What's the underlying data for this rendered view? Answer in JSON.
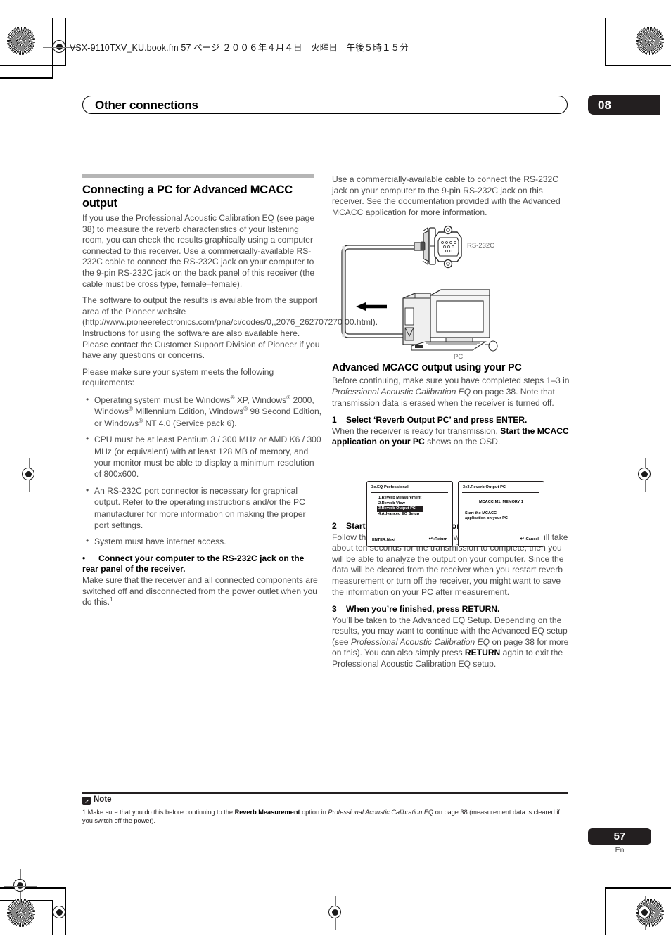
{
  "header": {
    "fm_line": "VSX-9110TXV_KU.book.fm 57 ページ ２００６年４月４日　火曜日　午後５時１５分"
  },
  "chapter": {
    "title": "Other connections",
    "number": "08"
  },
  "left_column": {
    "section_heading": "Connecting a PC for Advanced MCACC output",
    "p1_a": "If you use the Professional Acoustic Calibration EQ (see page 38) to measure the reverb characteristics of your listening room, you can check the results graphically using a computer connected to this receiver. Use a commercially-available RS-232C cable to connect the RS-232C jack on your computer to the 9-pin RS-232C jack on the back panel of this receiver (the cable must be cross type, female–female).",
    "p2": "The software to output the results is available from the support area of the Pioneer website (http://www.pioneerelectronics.com/pna/ci/codes/0,,2076_262707270,00.html). Instructions for using the software are also available here. Please contact the Customer Support Division of Pioneer if you have any questions or concerns.",
    "p3": "Please make sure your system meets the following requirements:",
    "requirements": [
      {
        "parts": [
          {
            "t": "Operating system must be Windows"
          },
          {
            "t": "®",
            "style": "reg"
          },
          {
            "t": " XP, Windows"
          },
          {
            "t": "®",
            "style": "reg"
          },
          {
            "t": " 2000, Windows"
          },
          {
            "t": "®",
            "style": "reg"
          },
          {
            "t": " Millennium Edition, Windows"
          },
          {
            "t": "®",
            "style": "reg"
          },
          {
            "t": " 98 Second Edition, or Windows"
          },
          {
            "t": "®",
            "style": "reg"
          },
          {
            "t": " NT 4.0 (Service pack 6)."
          }
        ]
      },
      {
        "parts": [
          {
            "t": "CPU must be at least Pentium 3 / 300 MHz or AMD K6 / 300 MHz (or equivalent) with at least 128 MB of memory, and your monitor must be able to display a minimum resolution of 800x600."
          }
        ]
      },
      {
        "parts": [
          {
            "t": "An RS-232C port connector is necessary for graphical output. Refer to the operating instructions and/or the PC manufacturer for more information on making the proper port settings."
          }
        ]
      },
      {
        "parts": [
          {
            "t": "System must have internet access."
          }
        ]
      }
    ],
    "bullet_bold_text": "Connect your computer to the RS-232C jack on the rear panel of the receiver.",
    "p4_a": "Make sure that the receiver and all connected components are switched off and disconnected from the power outlet when you do this.",
    "p4_footnote_marker": "1"
  },
  "right_column": {
    "p1": "Use a commercially-available cable to connect the RS-232C jack on your computer to the 9-pin RS-232C jack on this receiver. See the documentation provided with the Advanced MCACC application for more information.",
    "diagram": {
      "port_label": "RS-232C",
      "device_label": "PC"
    },
    "sub_heading": "Advanced MCACC output using your PC",
    "p2_a": "Before continuing, make sure you have completed steps 1–3 in ",
    "p2_italic": "Professional Acoustic Calibration EQ",
    "p2_b": " on page 38. Note that transmission data is erased when the receiver is turned off.",
    "steps": [
      {
        "number": "1",
        "title": "Select ‘Reverb Output PC’ and press ENTER.",
        "body_a": "When the receiver is ready for transmission, ",
        "body_bold": "Start the MCACC application on your PC",
        "body_b": " shows on the OSD."
      },
      {
        "number": "2",
        "title": "Start the MCACC application on your computer.",
        "body_a": "Follow the instructions provided with the application. It will take about ten seconds for the transmission to complete, then you will be able to analyze the output on your computer. Since the data will be cleared from the receiver when you restart reverb measurement or turn off the receiver, you might want to save the information on your PC after measurement.",
        "body_bold": "",
        "body_b": ""
      },
      {
        "number": "3",
        "title": "When you’re finished, press RETURN.",
        "body_a": "You’ll be taken to the Advanced EQ Setup. Depending on the results, you may want to continue with the Advanced EQ setup (see ",
        "body_italic": "Professional Acoustic Calibration EQ",
        "body_mid": " on page 38 for more on this). You can also simply press ",
        "body_bold": "RETURN",
        "body_b": " again to exit the Professional Acoustic Calibration EQ setup."
      }
    ]
  },
  "osd_screens": {
    "left": {
      "title": "3e.EQ Professional",
      "items": [
        "1.Reverb Measurement",
        "2.Reverb View",
        "3.Reverb Output PC",
        "4.Advanced EQ Setup"
      ],
      "selected_index": 2,
      "foot_left": "ENTER:Next",
      "foot_right": ":Return"
    },
    "right": {
      "title": "3e3.Reverb Output PC",
      "memory": "MCACC:M1. MEMORY 1",
      "message_line1": "Start the MCACC",
      "message_line2": "application on your PC",
      "foot_right": ":Cancel"
    }
  },
  "footnote": {
    "label": "Note",
    "marker": "1",
    "text_a": " Make sure that you do this before continuing to the ",
    "text_bold": "Reverb Measurement",
    "text_b": " option in ",
    "text_italic": "Professional Acoustic Calibration EQ",
    "text_c": " on page 38 (measurement data is cleared if you switch off the power)."
  },
  "page_footer": {
    "number": "57",
    "language": "En"
  },
  "colors": {
    "ink": "#231f20",
    "body_text": "#4c4c4c",
    "rule_grey": "#b5b5b5",
    "reg_mark": "#7d7d7d"
  }
}
